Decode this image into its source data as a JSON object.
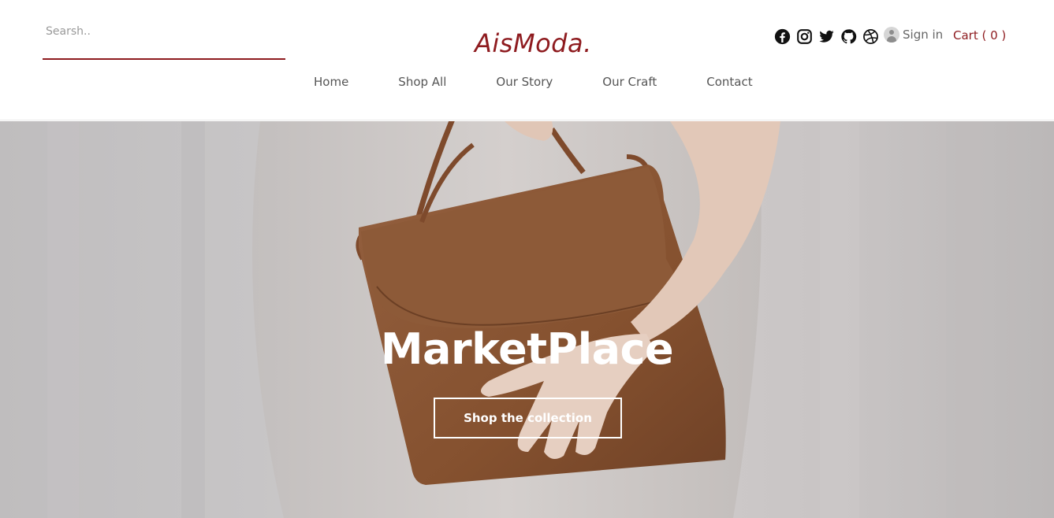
{
  "header": {
    "search": {
      "placeholder": "Searsh..",
      "value": ""
    },
    "logo": "AisModa.",
    "nav": [
      "Home",
      "Shop All",
      "Our Story",
      "Our Craft",
      "Contact"
    ],
    "social_icons": [
      "facebook-icon",
      "instagram-icon",
      "twitter-icon",
      "github-icon",
      "dribbble-icon"
    ],
    "signin_label": "Sign in",
    "cart_label": "Cart ( 0 )"
  },
  "hero": {
    "title": "MarketPlace",
    "button_label": "Shop the collection"
  },
  "colors": {
    "accent": "#8e1b1f",
    "nav_text": "#555555",
    "icon": "#111111",
    "hero_bg": "#c7c4c5",
    "bag": "#8a5436"
  }
}
